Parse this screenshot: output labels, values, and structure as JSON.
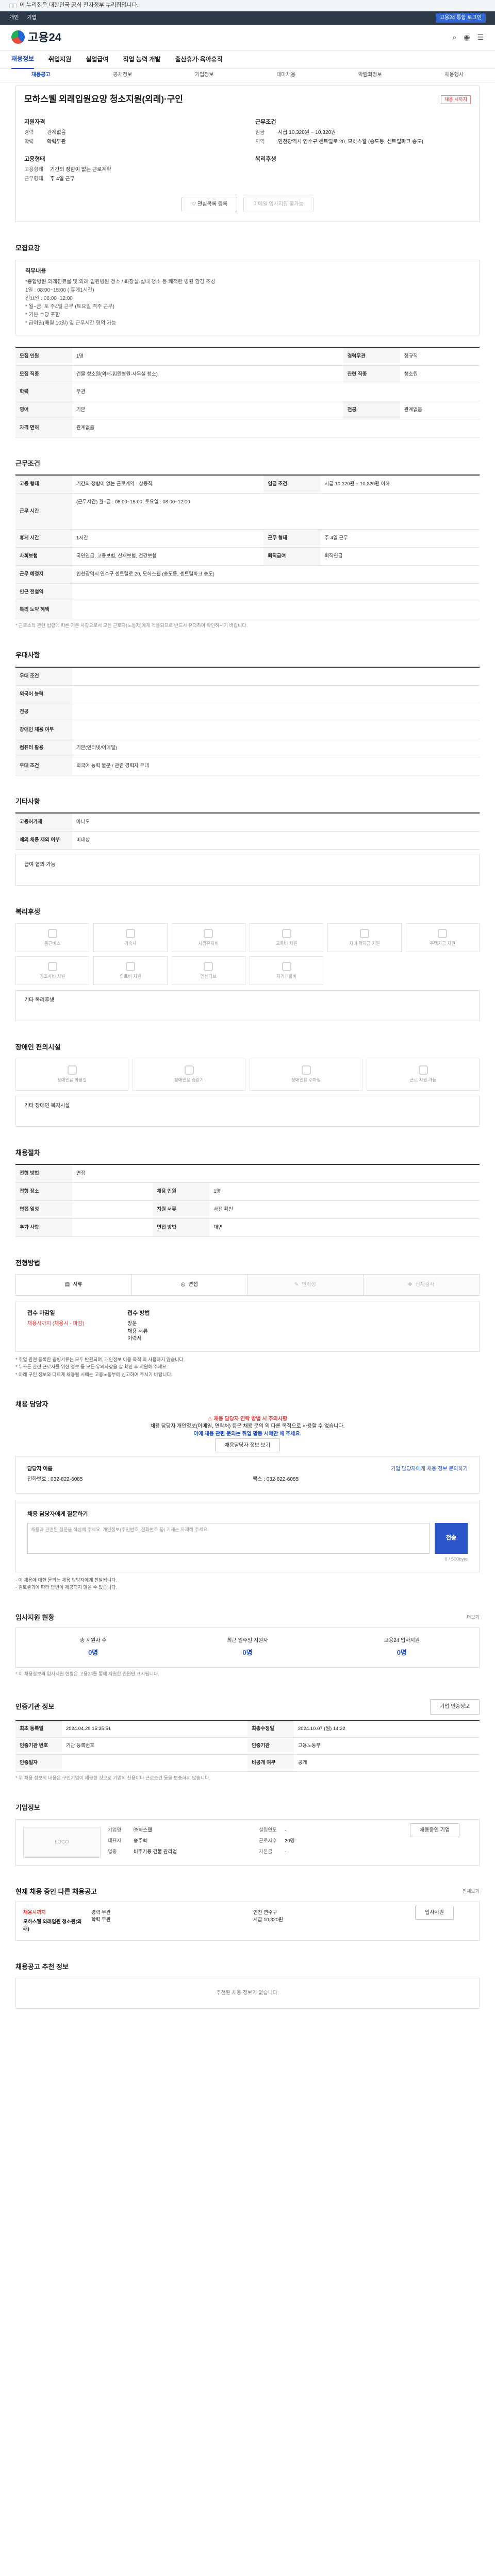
{
  "gov": {
    "text": "이 누리집은 대한민국 공식 전자정부 누리집입니다."
  },
  "topbar": {
    "links": [
      "개인",
      "기업"
    ],
    "tag": "고용24 통합 로그인"
  },
  "logo": {
    "text": "고용24"
  },
  "gnb": [
    "채용정보",
    "취업지원",
    "실업급여",
    "직업 능력 개발",
    "출산휴가·육아휴직"
  ],
  "subnav": [
    "채용공고",
    "공채정보",
    "기업정보",
    "테마채용",
    "박람회정보",
    "채용행사"
  ],
  "job": {
    "title": "모하스웰 외래입원요양 청소지원(외래)·구인",
    "badge": "채용 시까지",
    "left": {
      "title": "지원자격",
      "rows": [
        [
          "경력",
          "관계없음"
        ],
        [
          "학력",
          "학력무관"
        ]
      ]
    },
    "right": {
      "title": "근무조건",
      "rows": [
        [
          "임금",
          "시급 10,320원 ~ 10,320원"
        ],
        [
          "지역",
          "인천광역시 연수구 센트럴로 20, 모하스웰 (송도동, 센트럴파크 송도)"
        ]
      ]
    },
    "left2": {
      "title": "고용형태",
      "rows": [
        [
          "고용형태",
          "기간의 정함이 없는 근로계약"
        ],
        [
          "근무형태",
          "주 4일 근무"
        ]
      ]
    },
    "right2": {
      "title": "복리후생",
      "rows": []
    },
    "btn1": "관심목록 등록",
    "btn2": "이메일 입사지원 불가능"
  },
  "desc": {
    "title": "모집요강",
    "head": "직무내용",
    "lines": [
      "*종합병원 외래진료를 및 외래·입원병원 청소 / 화장실·실내 청소 등 쾌적한 병원 환경 조성",
      "1일 : 08:00~15:00 ( 휴게1시간)",
      "일요일 : 08:00~12:00",
      "* 월~금, 토 주4일 근무 (토요일 격주 근무)",
      "* 기본 수당 포함",
      "* 급여일(매월 10일) 및 근무시간 협의 가능"
    ]
  },
  "recruit": {
    "rows": [
      [
        "모집 인원",
        "1명",
        "경력무관",
        "정규직"
      ],
      [
        "모집 직종",
        "건물 청소원(외래·입원병원·사무실 청소)",
        "관련 직종",
        "청소원"
      ],
      [
        "학력",
        "무관",
        "",
        ""
      ],
      [
        "영어",
        "기본",
        "전공",
        "관계없음"
      ],
      [
        "자격 면허",
        "관계없음",
        "",
        ""
      ]
    ]
  },
  "work": {
    "title": "근무조건",
    "rows": [
      [
        "고용 형태",
        "기간의 정함이 없는 근로계약 · 상용직",
        "임금 조건",
        "시급 10,320원 ~ 10,320원 이하"
      ],
      [
        "근무 시간",
        "(근무시간) 월~금 : 08:00~15:00, 토요일 : 08:00~12:00",
        "",
        ""
      ],
      [
        "휴게 시간",
        "1시간",
        "근무 형태",
        "주 4일 근무"
      ],
      [
        "사회보험",
        "국민연금, 고용보험, 산재보험, 건강보험",
        "퇴직급여",
        "퇴직연금"
      ],
      [
        "근무 예정지",
        "인천광역시 연수구 센트럴로 20, 모하스웰 (송도동, 센트럴파크 송도)",
        "",
        ""
      ],
      [
        "인근 전철역",
        "",
        "",
        " "
      ],
      [
        "복리 노약 혜택",
        "",
        "",
        ""
      ]
    ],
    "note": "* 근로소득 관련 법령에 따른 기본 사항으로서 모든 근로자(노동자)에게 적용되므로 반드시 유의하여 확인하시기 바랍니다."
  },
  "career": {
    "title": "우대사항",
    "rows": [
      [
        "우대 조건",
        ""
      ],
      [
        "외국어 능력",
        ""
      ],
      [
        "전공",
        ""
      ],
      [
        "장애인 채용 여부",
        ""
      ],
      [
        "컴퓨터 활용",
        "기본(인터넷/이메일)"
      ],
      [
        "우대 조건",
        "외국어 능력 불문 / 관련 경력자 우대"
      ]
    ]
  },
  "etc": {
    "title": "기타사항",
    "rows": [
      [
        "고용허가제",
        "아니오"
      ],
      [
        "해외 채용 제외 여부",
        "비대상"
      ]
    ],
    "box": "급여 협의 가능"
  },
  "welfare": {
    "title": "복리후생",
    "items": [
      "통근버스",
      "기숙사",
      "차량유지비",
      "교육비 지원",
      "자녀 학자금 지원",
      "주택자금 지원",
      "경조사비 지원",
      "의료비 지원",
      "인센티브",
      "자기개발비",
      "",
      ""
    ],
    "box": "기타 복리후생"
  },
  "disab": {
    "title": "장애인 편의시설",
    "items": [
      "장애인용 화장실",
      "장애인용 승강기",
      "장애인용 주차장",
      "근로 지원 가능"
    ],
    "box": "기타 장애인 복지시설"
  },
  "apply": {
    "title": "채용절차",
    "rows": [
      [
        "전형 방법",
        "면접"
      ],
      [
        "접수 마감일",
        "채용시까지 (2024.12.31)"
      ],
      [
        "접수 방법",
        "고용24"
      ],
      [
        "제출 서류",
        "이력서"
      ]
    ],
    "rows2": [
      [
        "전형 장소",
        "",
        "채용 인원",
        "1명"
      ],
      [
        "면접 일정",
        "",
        "지원 서류",
        "사전 확인"
      ],
      [
        "추가 사항",
        "",
        "면접 방법",
        "대면"
      ]
    ]
  },
  "how": {
    "title": "전형방법",
    "tabs": [
      "서류",
      "면접",
      "인적성",
      "신체검사"
    ],
    "left": {
      "head": "접수 마감일",
      "val": "채용시까지 (채용시 - 마감)"
    },
    "right": {
      "head": "접수 방법",
      "items": [
        "방문",
        "채용 서류",
        "이력서"
      ]
    },
    "bullets": [
      "* 취업 관련 등록한 증빙서류는 모두 반환되며, 개인정보 이용 목적 외 사용하지 않습니다.",
      "* 누구든 관련 근로자를 위한 정보 등 모든 유의사항을 잘 확인 후 지원해 주세요.",
      "* 아래 구인 정보와 다르게 채용될 시에는 고용노동부에 신고하여 주시기 바랍니다."
    ]
  },
  "manager": {
    "title": "채용 담당자",
    "alert": "채용 담당자 연락 방법 시 주의사항",
    "line1": "채용 담당자 개인정보(이메일, 연락처) 등은 채용 문의 외 다른 목적으로 사용할 수 없습니다.",
    "line2": "이에 채용 관련 문의는 취업 활동 시에만 해 주세요.",
    "btn": "채용담당자 정보 보기",
    "name_k": "담당자 이름",
    "name_v": "",
    "tel_k": "전화번호",
    "tel_v": "032-822-6085",
    "fax_k": "팩스",
    "fax_v": "032-822-6085",
    "link": "기업 담당자에게 채용 정보 문의하기"
  },
  "ask": {
    "title": "채용 담당자에게 질문하기",
    "placeholder": "채용과 관련된 질문을 작성해 주세요. 개인정보(주민번호, 전화번호 등) 기재는 자제해 주세요.",
    "send": "전송",
    "count": "0 / 500byte",
    "b1": "· 이 채용에 대한 문의는 채용 담당자에게 전달됩니다.",
    "b2": "· 검토결과에 따라 답변이 제공되지 않을 수 있습니다."
  },
  "stats": {
    "title": "입사지원 현황",
    "link": "더보기",
    "items": [
      [
        "총 지원자 수",
        "0명"
      ],
      [
        "최근 일주일 지원자",
        "0명"
      ],
      [
        "고용24 입사지원",
        "0명"
      ]
    ],
    "note": "* 이 채용정보의 입사지원 현황은 고용24를 통해 지원한 인원만 표시됩니다."
  },
  "info": {
    "title": "인증기관 정보",
    "btn": "기업 인증정보",
    "rows": [
      [
        "최초 등록일",
        "2024.04.29 15:35:51",
        "최종수정일",
        "2024.10.07 (월) 14:22"
      ],
      [
        "인증기관 번호",
        "기관 등록번호",
        "인증기관",
        "고용노동부"
      ],
      [
        "인증일자",
        "",
        "비공개 여부",
        "공개"
      ]
    ],
    "note": "* 위 채용 정보의 내용은 구인기업이 제공한 것으로 기업의 신용이나 근로조건 등을 보증하지 않습니다."
  },
  "company": {
    "title": "기업정보",
    "logo": "LOGO",
    "btn": "채용중인 기업",
    "rows": [
      [
        "기업명",
        "㈜하스웰"
      ],
      [
        "대표자",
        "송주혁"
      ],
      [
        "업종",
        "비주거용 건물 관리업"
      ]
    ],
    "rows2": [
      [
        "설립연도",
        "-"
      ],
      [
        "근로자수",
        "20명"
      ],
      [
        "자본금",
        "-"
      ]
    ]
  },
  "other": {
    "title": "현재 채용 중인 다른 채용공고",
    "more": "전체보기",
    "tag": "채용시까지",
    "job": "모하스웰 외래입원 청소원(외래)",
    "list": [
      "경력 무관",
      "학력 무관",
      "인천 연수구",
      "시급 10,320원"
    ],
    "btn": "입사지원"
  },
  "recommend": {
    "title": "채용공고 추천 정보",
    "empty": "추천된 채용 정보가 없습니다."
  }
}
